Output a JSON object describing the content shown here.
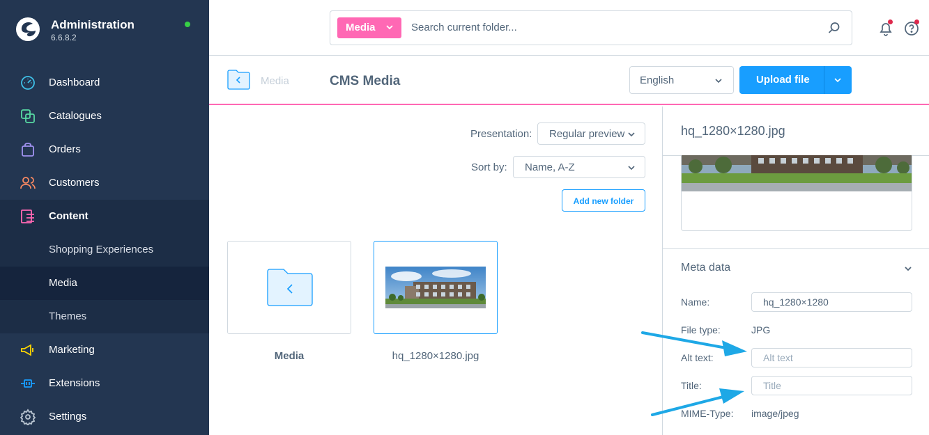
{
  "brand": {
    "title": "Administration",
    "version": "6.6.8.2"
  },
  "sidebar": {
    "items": [
      {
        "label": "Dashboard"
      },
      {
        "label": "Catalogues"
      },
      {
        "label": "Orders"
      },
      {
        "label": "Customers"
      },
      {
        "label": "Content"
      },
      {
        "label": "Shopping Experiences"
      },
      {
        "label": "Media"
      },
      {
        "label": "Themes"
      },
      {
        "label": "Marketing"
      },
      {
        "label": "Extensions"
      },
      {
        "label": "Settings"
      }
    ]
  },
  "search": {
    "module": "Media",
    "placeholder": "Search current folder..."
  },
  "header": {
    "breadcrumb": "Media",
    "title": "CMS Media",
    "language": "English",
    "upload_label": "Upload file"
  },
  "toolbar": {
    "presentation_label": "Presentation:",
    "presentation_value": "Regular preview",
    "sort_label": "Sort by:",
    "sort_value": "Name, A-Z",
    "add_folder_label": "Add new folder"
  },
  "grid": {
    "items": [
      {
        "label": "Media"
      },
      {
        "label": "hq_1280×1280.jpg"
      }
    ]
  },
  "panel": {
    "file_title": "hq_1280×1280.jpg",
    "meta_title": "Meta data",
    "name_label": "Name:",
    "name_value": "hq_1280×1280",
    "filetype_label": "File type:",
    "filetype_value": "JPG",
    "alt_label": "Alt text:",
    "alt_placeholder": "Alt text",
    "title_label": "Title:",
    "title_placeholder": "Title",
    "mime_label": "MIME-Type:",
    "mime_value": "image/jpeg"
  },
  "colors": {
    "sidebar_bg": "#233651",
    "accent_pink": "#ff68b4",
    "primary_blue": "#189eff",
    "annotation_arrow": "#1ea8e6"
  }
}
